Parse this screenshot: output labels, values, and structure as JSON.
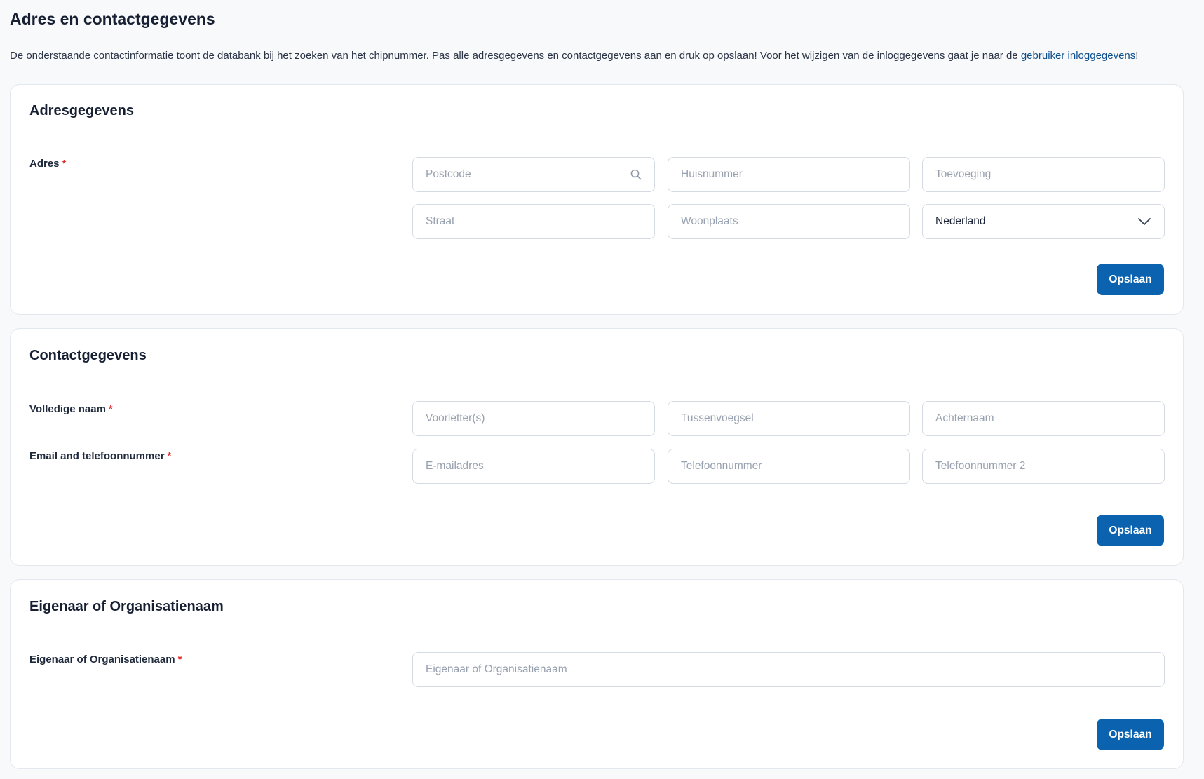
{
  "page": {
    "title": "Adres en contactgegevens",
    "intro_text": "De onderstaande contactinformatie toont de databank bij het zoeken van het chipnummer. Pas alle adresgegevens en contactgegevens aan en druk op opslaan! Voor het wijzigen van de inloggegevens gaat je naar de ",
    "intro_link": "gebruiker inloggegevens",
    "intro_end": "!"
  },
  "address_card": {
    "title": "Adresgegevens",
    "label": "Adres",
    "required_mark": "*",
    "postcode_placeholder": "Postcode",
    "huisnummer_placeholder": "Huisnummer",
    "toevoeging_placeholder": "Toevoeging",
    "straat_placeholder": "Straat",
    "woonplaats_placeholder": "Woonplaats",
    "country_value": "Nederland",
    "save_label": "Opslaan"
  },
  "contact_card": {
    "title": "Contactgegevens",
    "name_label": "Volledige naam",
    "contact_label": "Email and telefoonnummer",
    "required_mark": "*",
    "voorletters_placeholder": "Voorletter(s)",
    "tussenvoegsel_placeholder": "Tussenvoegsel",
    "achternaam_placeholder": "Achternaam",
    "email_placeholder": "E-mailadres",
    "telefoon_placeholder": "Telefoonnummer",
    "telefoon2_placeholder": "Telefoonnummer 2",
    "save_label": "Opslaan"
  },
  "owner_card": {
    "title": "Eigenaar of Organisatienaam",
    "label": "Eigenaar of Organisatienaam",
    "required_mark": "*",
    "owner_placeholder": "Eigenaar of Organisatienaam",
    "save_label": "Opslaan"
  },
  "colors": {
    "accent": "#0b63b0",
    "link": "#0d4f8c",
    "required": "#e0312f",
    "background": "#f8f9fb"
  },
  "icons": {
    "postcode_search": "search-icon",
    "country_dropdown": "chevron-down-icon"
  }
}
